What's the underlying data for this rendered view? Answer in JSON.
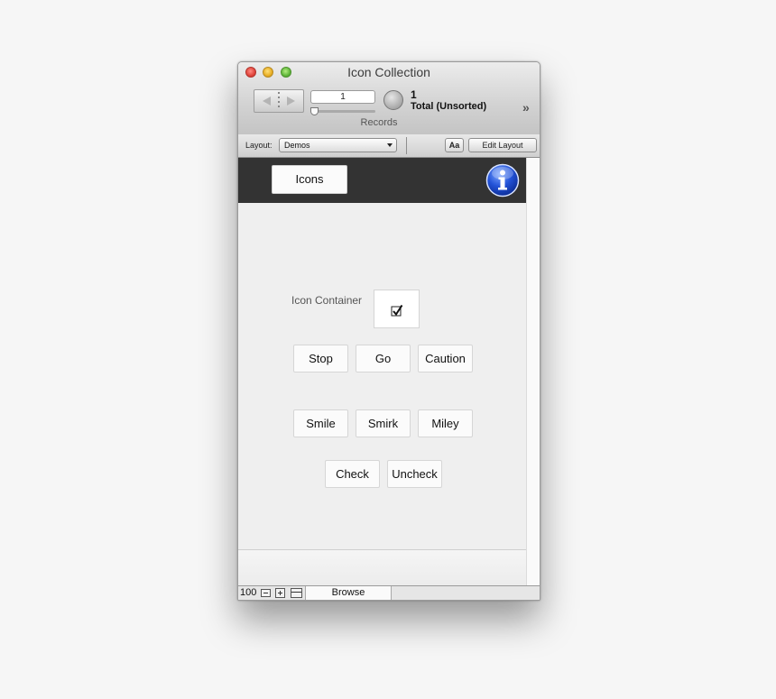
{
  "window": {
    "title": "Icon Collection"
  },
  "toolbar": {
    "record_number": "1",
    "records_label": "Records",
    "found_count": "1",
    "found_total": "Total (Unsorted)",
    "more_glyph": "»"
  },
  "layout_bar": {
    "layout_label": "Layout:",
    "layout_selected": "Demos",
    "aa_label": "Aa",
    "edit_layout_label": "Edit Layout"
  },
  "header": {
    "icons_button_label": "Icons",
    "info_icon": "info-icon"
  },
  "container": {
    "label": "Icon Container",
    "icon": "checkbox-checked-icon"
  },
  "buttons": {
    "row1": [
      "Stop",
      "Go",
      "Caution"
    ],
    "row2": [
      "Smile",
      "Smirk",
      "Miley"
    ],
    "row3": [
      "Check",
      "Uncheck"
    ]
  },
  "statusbar": {
    "zoom": "100",
    "mode": "Browse"
  },
  "colors": {
    "header_band": "#333333",
    "info_blue": "#1f4fd6",
    "content_bg": "#efefef"
  }
}
